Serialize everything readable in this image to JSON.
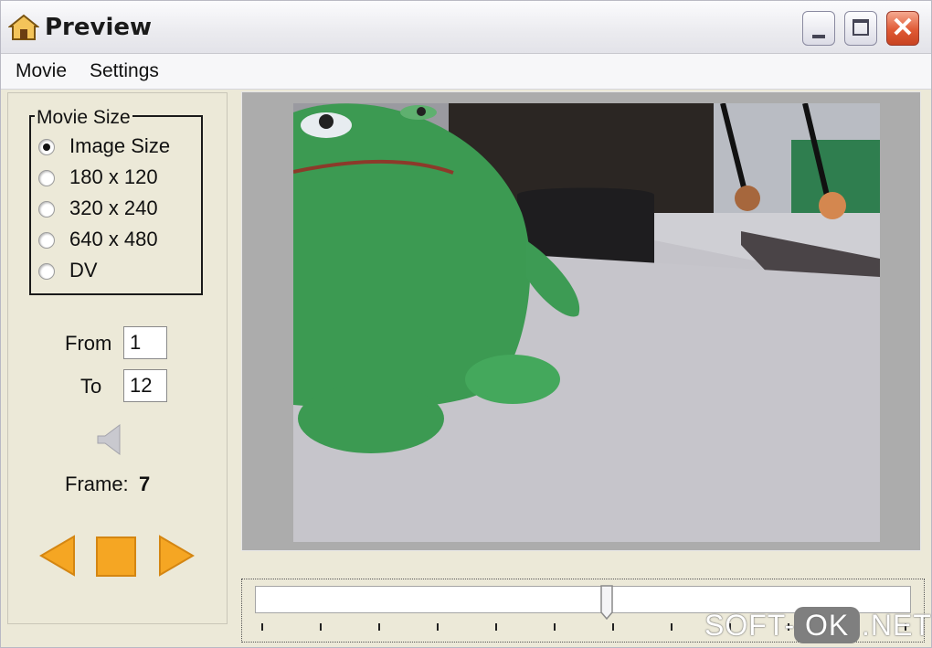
{
  "window": {
    "title": "Preview",
    "app_icon": "home-icon"
  },
  "titlebar_buttons": {
    "minimize": "minimize-icon",
    "maximize": "maximize-icon",
    "close": "close-icon",
    "close_glyph": "✕"
  },
  "menu": {
    "items": [
      "Movie",
      "Settings"
    ]
  },
  "movie_size": {
    "title": "Movie Size",
    "options": [
      "Image Size",
      "180 x 120",
      "320 x 240",
      "640 x 480",
      "DV"
    ],
    "selected": "Image Size"
  },
  "range": {
    "from_label": "From",
    "from_value": "1",
    "to_label": "To",
    "to_value": "12"
  },
  "sound_icon": "speaker-icon",
  "frame": {
    "label": "Frame:",
    "value": "7"
  },
  "playback": {
    "prev": "play-backward-icon",
    "stop": "stop-icon",
    "next": "play-forward-icon"
  },
  "slider": {
    "position_fraction": 0.54,
    "tick_count": 12
  },
  "watermark": {
    "left": "SOFT-",
    "badge": "OK",
    "right": ".NET"
  },
  "colors": {
    "accent_orange": "#f5a623",
    "close_red": "#e05a35",
    "plush_green": "#3c9a52"
  }
}
